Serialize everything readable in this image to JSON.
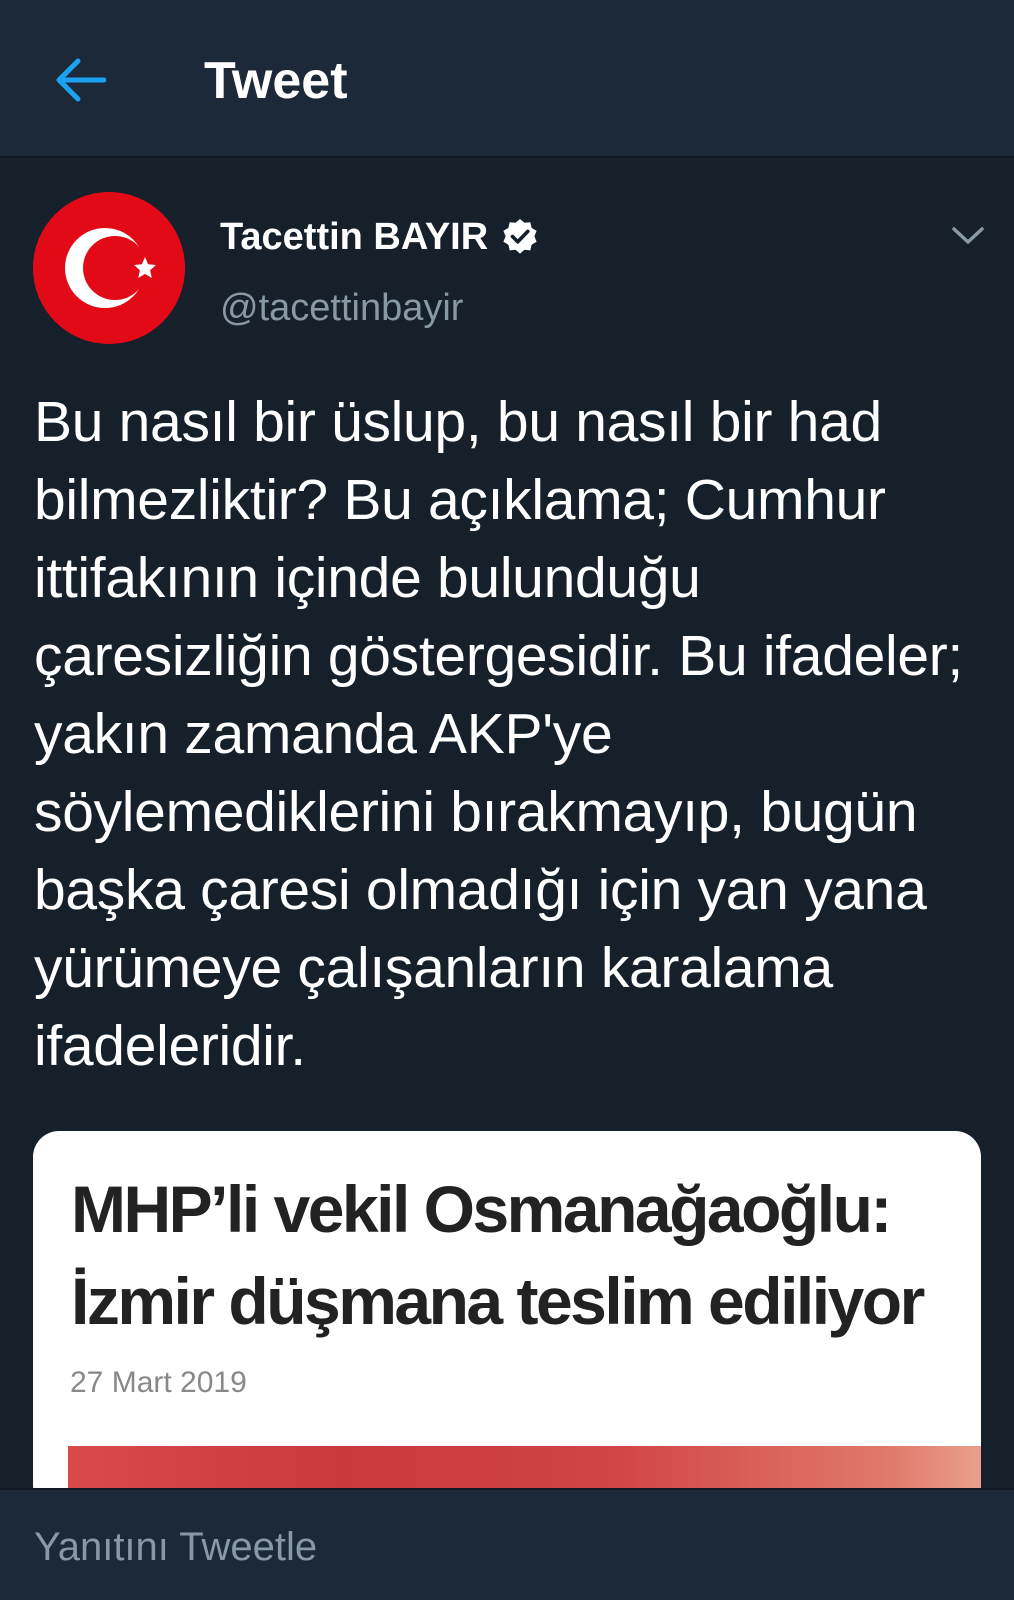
{
  "header": {
    "title": "Tweet",
    "back_icon": "arrow-left-icon",
    "accent_color": "#1da1f2"
  },
  "tweet": {
    "author": {
      "display_name": "Tacettin BAYIR",
      "handle": "@tacettinbayir",
      "verified": true,
      "avatar": "turkish-flag"
    },
    "text": "Bu nasıl bir üslup, bu nasıl bir had bilmezliktir? Bu açıklama; Cumhur ittifakının içinde bulunduğu çaresizliğin göstergesidir. Bu ifadeler; yakın zamanda AKP'ye söylemediklerini bırakmayıp, bugün  başka çaresi olmadığı için yan yana yürümeye çalışanların karalama ifadeleridir.",
    "media": {
      "headline": "MHP’li vekil Osmanağaoğlu:\nİzmir düşmana teslim ediliyor",
      "date": "27 Mart 2019"
    }
  },
  "reply": {
    "placeholder": "Yanıtını Tweetle"
  },
  "colors": {
    "background": "#15202b",
    "header_bg": "#1c2938",
    "secondary_text": "#8899a6",
    "flag_red": "#e30a17"
  }
}
